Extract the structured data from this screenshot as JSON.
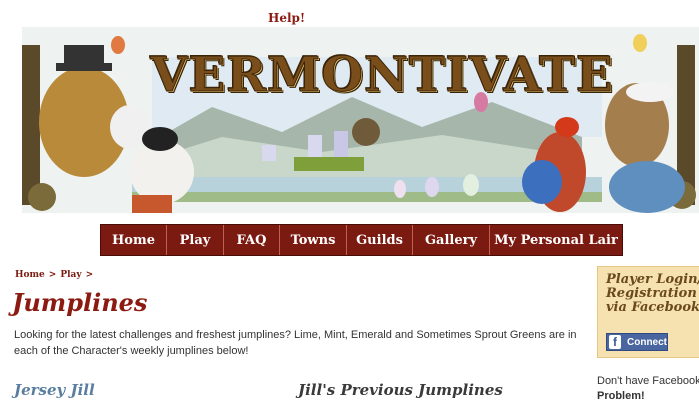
{
  "header": {
    "help_label": "Help!"
  },
  "banner": {
    "logo_text": "VERMONTIVATE"
  },
  "nav": {
    "items": [
      "Home",
      "Play",
      "FAQ",
      "Towns",
      "Guilds",
      "Gallery",
      "My Personal Lair"
    ]
  },
  "breadcrumb": {
    "home": "Home",
    "sep1": ">",
    "play": "Play",
    "sep2": ">"
  },
  "main": {
    "title": "Jumplines",
    "intro": "Looking for the latest challenges and freshest jumplines? Lime, Mint, Emerald and Sometimes Sprout Greens are in each of the Character's weekly jumplines below!",
    "jersey_heading": "Jersey Jill",
    "previous_heading": "Jill's Previous Jumplines"
  },
  "sidebar": {
    "login_title": "Player Login/ Registration via Facebook",
    "connect_label": "Connect",
    "fb_glyph": "f",
    "no_facebook_text": "Don't have Facebook",
    "problem_text": "Problem!"
  },
  "colors": {
    "nav_bg": "#7a1a10",
    "accent": "#8b1a10",
    "login_bg": "#f6e1b0",
    "facebook": "#4a66a0"
  }
}
